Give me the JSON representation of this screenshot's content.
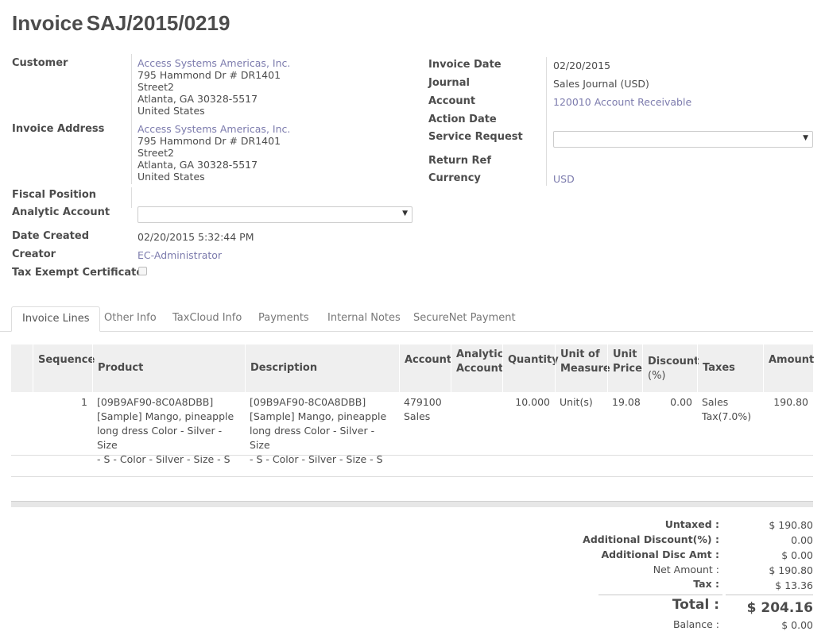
{
  "header": {
    "title_word": "Invoice",
    "invoice_number": "SAJ/2015/0219"
  },
  "left": {
    "customer_label": "Customer",
    "customer": {
      "name": "Access Systems Americas, Inc.",
      "line1": "795 Hammond Dr # DR1401",
      "line2": "Street2",
      "line3": "Atlanta, GA 30328-5517",
      "line4": "United States"
    },
    "invoice_address_label": "Invoice Address",
    "invoice_address": {
      "name": "Access Systems Americas, Inc.",
      "line1": "795 Hammond Dr # DR1401",
      "line2": "Street2",
      "line3": "Atlanta, GA 30328-5517",
      "line4": "United States"
    },
    "fiscal_position_label": "Fiscal Position",
    "analytic_account_label": "Analytic Account",
    "analytic_account_value": "",
    "date_created_label": "Date Created",
    "date_created": "02/20/2015 5:32:44 PM",
    "creator_label": "Creator",
    "creator": "EC-Administrator",
    "tax_exempt_label": "Tax Exempt Certificate"
  },
  "right": {
    "invoice_date_label": "Invoice Date",
    "invoice_date": "02/20/2015",
    "journal_label": "Journal",
    "journal": "Sales Journal (USD)",
    "account_label": "Account",
    "account": "120010 Account Receivable",
    "action_date_label": "Action Date",
    "service_request_label": "Service Request",
    "service_request_value": "",
    "return_ref_label": "Return Ref",
    "currency_label": "Currency",
    "currency": "USD"
  },
  "tabs": [
    {
      "label": "Invoice Lines"
    },
    {
      "label": "Other Info"
    },
    {
      "label": "TaxCloud Info"
    },
    {
      "label": "Payments"
    },
    {
      "label": "Internal Notes"
    },
    {
      "label": "SecureNet Payment"
    }
  ],
  "table": {
    "headers": {
      "sequence": "Sequence",
      "product": "Product",
      "description": "Description",
      "account": "Account",
      "analytic_1": "Analytic",
      "analytic_2": "Account",
      "quantity": "Quantity",
      "uom_1": "Unit of",
      "uom_2": "Measure",
      "price_1": "Unit",
      "price_2": "Price",
      "discount_1": "Discount",
      "discount_2": "(%)",
      "taxes": "Taxes",
      "amount": "Amount"
    },
    "rows": [
      {
        "sequence": "1",
        "product": [
          "[09B9AF90-8C0A8DBB]",
          "[Sample] Mango, pineapple",
          "long dress Color - Silver - Size",
          "- S - Color - Silver - Size - S"
        ],
        "description": [
          "[09B9AF90-8C0A8DBB]",
          "[Sample] Mango, pineapple",
          "long dress Color - Silver - Size",
          "- S - Color - Silver - Size - S"
        ],
        "account": [
          "479100",
          "Sales"
        ],
        "quantity": "10.000",
        "uom": "Unit(s)",
        "unit_price": "19.08",
        "discount": "0.00",
        "taxes": [
          "Sales",
          "Tax(7.0%)"
        ],
        "amount": "190.80"
      }
    ]
  },
  "totals": {
    "untaxed_label": "Untaxed :",
    "untaxed": "$ 190.80",
    "add_discount_pct_label": "Additional Discount(%) :",
    "add_discount_pct": "0.00",
    "add_disc_amt_label": "Additional Disc Amt :",
    "add_disc_amt": "$ 0.00",
    "net_amount_label": "Net Amount :",
    "net_amount": "$ 190.80",
    "tax_label": "Tax :",
    "tax": "$ 13.36",
    "total_label": "Total :",
    "total": "$ 204.16",
    "balance_label": "Balance :",
    "balance": "$ 0.00"
  },
  "colors": {
    "link": "#7c7bad",
    "text": "#4c4c4c",
    "header_bg": "#efefef"
  }
}
